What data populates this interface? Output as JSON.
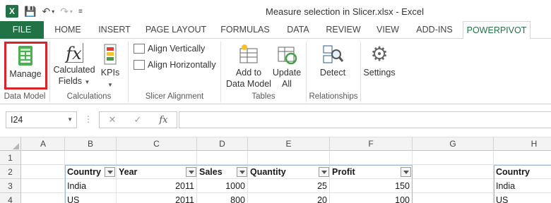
{
  "titlebar": {
    "title": "Measure selection in Slicer.xlsx - Excel",
    "logo": "X"
  },
  "tabs": [
    {
      "label": "FILE"
    },
    {
      "label": "HOME"
    },
    {
      "label": "INSERT"
    },
    {
      "label": "PAGE LAYOUT"
    },
    {
      "label": "FORMULAS"
    },
    {
      "label": "DATA"
    },
    {
      "label": "REVIEW"
    },
    {
      "label": "VIEW"
    },
    {
      "label": "ADD-INS"
    },
    {
      "label": "POWERPIVOT"
    }
  ],
  "ribbon": {
    "manage": "Manage",
    "calc_fields_1": "Calculated",
    "calc_fields_2": "Fields",
    "kpis": "KPIs",
    "align_vert": "Align Vertically",
    "align_horiz": "Align Horizontally",
    "add_dm_1": "Add to",
    "add_dm_2": "Data Model",
    "update_1": "Update",
    "update_2": "All",
    "detect": "Detect",
    "settings": "Settings",
    "groups": {
      "data_model": "Data Model",
      "calculations": "Calculations",
      "slicer_alignment": "Slicer Alignment",
      "tables": "Tables",
      "relationships": "Relationships"
    }
  },
  "formula_bar": {
    "name_box": "I24",
    "fx": "fx",
    "cancel": "✕",
    "enter": "✓",
    "dots": "⋮"
  },
  "columns": [
    "A",
    "B",
    "C",
    "D",
    "E",
    "F",
    "G",
    "H"
  ],
  "rows": [
    "1",
    "2",
    "3",
    "4"
  ],
  "table": {
    "headers": [
      "Country",
      "Year",
      "Sales",
      "Quantity",
      "Profit"
    ],
    "rows": [
      [
        "India",
        "2011",
        "1000",
        "25",
        "150"
      ],
      [
        "US",
        "2011",
        "800",
        "20",
        "100"
      ]
    ]
  },
  "table2": {
    "header": "Country",
    "rows": [
      "India",
      "US"
    ]
  },
  "colors": {
    "excel_green": "#217346",
    "highlight_red": "#d9232a"
  }
}
